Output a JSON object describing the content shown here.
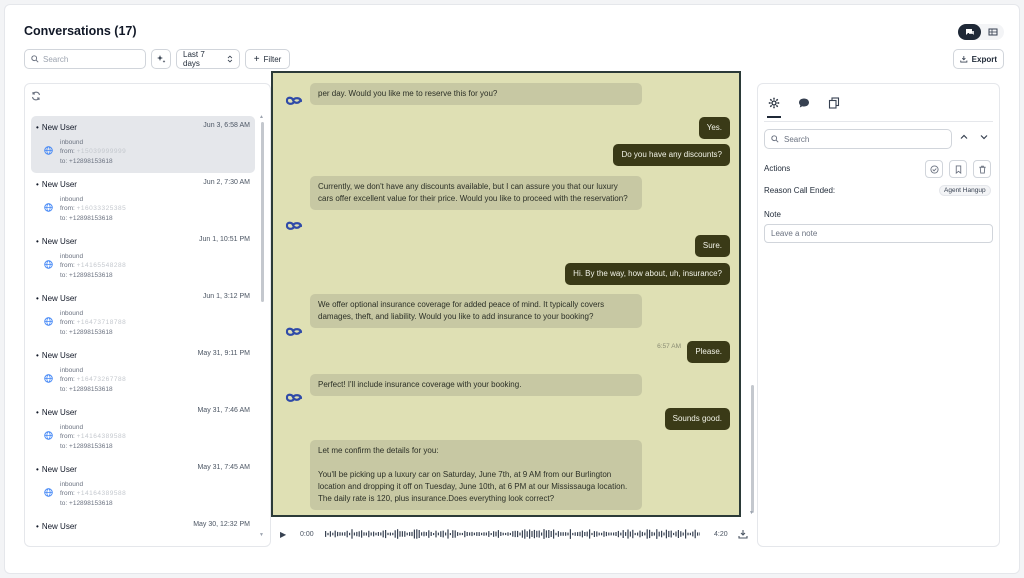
{
  "header": {
    "title": "Conversations (17)",
    "export_label": "Export",
    "view_toggle": [
      "chat-view-icon",
      "table-view-icon"
    ]
  },
  "toolbar": {
    "search_placeholder": "Search",
    "date_range": "Last 7 days",
    "filter_label": "Filter"
  },
  "conversations": [
    {
      "name": "New User",
      "date": "Jun 3, 6:58 AM",
      "direction": "inbound",
      "from_label": "from:",
      "from_value": "+15039999999",
      "to": "to: +12898153618",
      "selected": true
    },
    {
      "name": "New User",
      "date": "Jun 2, 7:30 AM",
      "direction": "inbound",
      "from_label": "from:",
      "from_value": "+16033325385",
      "to": "to: +12898153618",
      "selected": false
    },
    {
      "name": "New User",
      "date": "Jun 1, 10:51 PM",
      "direction": "inbound",
      "from_label": "from:",
      "from_value": "+14165548288",
      "to": "to: +12898153618",
      "selected": false
    },
    {
      "name": "New User",
      "date": "Jun 1, 3:12 PM",
      "direction": "inbound",
      "from_label": "from:",
      "from_value": "+16473718788",
      "to": "to: +12898153618",
      "selected": false
    },
    {
      "name": "New User",
      "date": "May 31, 9:11 PM",
      "direction": "inbound",
      "from_label": "from:",
      "from_value": "+16473267788",
      "to": "to: +12898153618",
      "selected": false
    },
    {
      "name": "New User",
      "date": "May 31, 7:46 AM",
      "direction": "inbound",
      "from_label": "from:",
      "from_value": "+14164389588",
      "to": "to: +12898153618",
      "selected": false
    },
    {
      "name": "New User",
      "date": "May 31, 7:45 AM",
      "direction": "inbound",
      "from_label": "from:",
      "from_value": "+14164389588",
      "to": "to: +12898153618",
      "selected": false
    },
    {
      "name": "New User",
      "date": "May 30, 12:32 PM",
      "direction": "",
      "from_label": "",
      "from_value": "",
      "to": "",
      "selected": false
    }
  ],
  "messages": [
    {
      "role": "bot",
      "text": "per day. Would you like me to reserve this for you?"
    },
    {
      "role": "user",
      "text": "Yes."
    },
    {
      "role": "user",
      "text": "Do you have any discounts?"
    },
    {
      "role": "bot",
      "text": "Currently, we don't have any discounts available, but I can assure you that our luxury cars offer excellent value for their price. Would you like to proceed with the reservation?"
    },
    {
      "role": "user",
      "text": "Sure."
    },
    {
      "role": "user",
      "text": "Hi. By the way, how about, uh, insurance?"
    },
    {
      "role": "bot",
      "text": "We offer optional insurance coverage for added peace of mind. It typically covers damages, theft, and liability. Would you like to add insurance to your booking?"
    },
    {
      "role": "user",
      "text": "Please.",
      "time": "6:57 AM"
    },
    {
      "role": "bot",
      "text": "Perfect! I'll include insurance coverage with your booking."
    },
    {
      "role": "user",
      "text": "Sounds good."
    },
    {
      "role": "bot",
      "text": "Let me confirm the details for you:",
      "text2": "You'll be picking up a luxury car on Saturday, June 7th, at 9 AM from our Burlington location and dropping it off on Tuesday, June 10th, at 6 PM at our Mississauga location. The daily rate is 120, plus insurance.Does everything look correct?"
    }
  ],
  "player": {
    "current_time": "0:00",
    "duration": "4:20"
  },
  "details": {
    "search_placeholder": "Search",
    "actions_label": "Actions",
    "reason_label": "Reason Call Ended:",
    "reason_value": "Agent Hangup",
    "note_label": "Note",
    "note_placeholder": "Leave a note"
  },
  "colors": {
    "chat_bg": "#dfe0b4",
    "user_bubble": "#3a3a17",
    "bot_bubble": "#c7c8a3",
    "bot_icon": "#2f4aa8"
  }
}
